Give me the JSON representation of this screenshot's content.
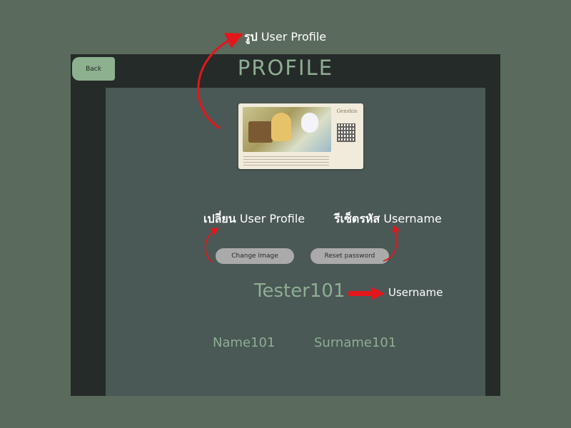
{
  "annotations": {
    "profile_image": {
      "thai": "รูป",
      "en": "User Profile"
    },
    "change_profile": {
      "thai": "เปลี่ยน",
      "en": "User Profile"
    },
    "reset_username": {
      "thai": "รีเซ็ตรหัส",
      "en": "Username"
    },
    "username": "Username"
  },
  "header": {
    "back_label": "Back",
    "title": "PROFILE"
  },
  "profile": {
    "card_logo": "Genshin",
    "change_image_label": "Change Image",
    "reset_password_label": "Reset password",
    "username": "Tester101",
    "name": "Name101",
    "surname": "Surname101"
  },
  "colors": {
    "background": "#5a6a5c",
    "app_dark": "#252b29",
    "panel": "#4a5856",
    "accent_green": "#8fae93",
    "back_button": "#8db08f",
    "pill_button": "#aaaaaa",
    "annotation_arrow": "#e3161b"
  }
}
